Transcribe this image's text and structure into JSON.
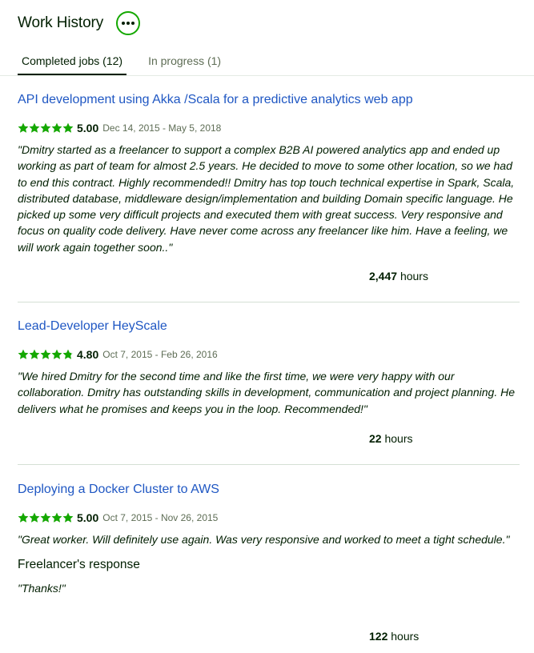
{
  "header": {
    "title": "Work History",
    "more_icon": "more-horizontal-icon"
  },
  "tabs": [
    {
      "label": "Completed jobs (12)",
      "active": true
    },
    {
      "label": "In progress (1)",
      "active": false
    }
  ],
  "colors": {
    "accent": "#14a800",
    "link": "#1f57c3",
    "text": "#001e00",
    "muted": "#5e6d55"
  },
  "jobs": [
    {
      "title": "API development using Akka /Scala for a predictive analytics web app",
      "rating": "5.00",
      "stars_filled": 5,
      "dates": "Dec 14, 2015 - May 5, 2018",
      "feedback": "\"Dmitry started as a freelancer to support a complex B2B AI powered analytics app and ended up working as part of team for almost 2.5 years. He decided to move to some other location, so we had to end this contract. Highly recommended!! Dmitry has top touch technical expertise in Spark, Scala, distributed database, middleware design/implementation and building Domain specific language. He picked up some very difficult projects and executed them with great success. Very responsive and focus on quality code delivery. Have never come across any freelancer like him. Have a feeling, we will work again together soon..\"",
      "hours_value": "2,447",
      "hours_unit": "hours"
    },
    {
      "title": "Lead-Developer HeyScale",
      "rating": "4.80",
      "stars_filled": 4.8,
      "dates": "Oct 7, 2015 - Feb 26, 2016",
      "feedback": "\"We hired Dmitry for the second time and like the first time, we were very happy with our collaboration. Dmitry has outstanding skills in development, communication and project planning. He delivers what he promises and keeps you in the loop. Recommended!\"",
      "hours_value": "22",
      "hours_unit": "hours"
    },
    {
      "title": "Deploying a Docker Cluster to AWS",
      "rating": "5.00",
      "stars_filled": 5,
      "dates": "Oct 7, 2015 - Nov 26, 2015",
      "feedback": "\"Great worker. Will definitely use again. Was very responsive and worked to meet a tight schedule.\"",
      "response_title": "Freelancer's response",
      "response_text": "\"Thanks!\"",
      "hours_value": "122",
      "hours_unit": "hours"
    }
  ]
}
